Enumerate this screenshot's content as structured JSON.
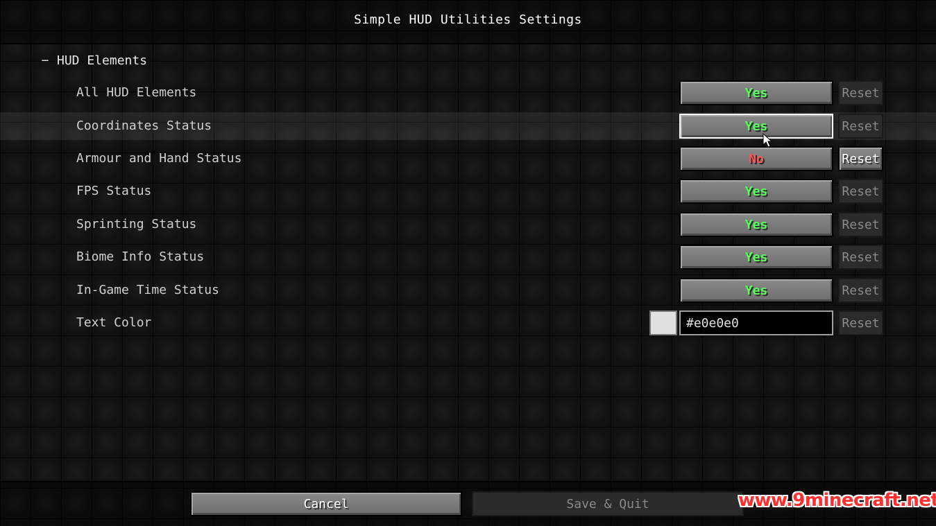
{
  "screen": {
    "title": "Simple HUD Utilities Settings"
  },
  "category": {
    "collapse_symbol": "−",
    "label": "HUD Elements"
  },
  "options": [
    {
      "label": "All HUD Elements",
      "value": "Yes",
      "reset": "Reset",
      "value_color": "#55ff55",
      "reset_enabled": false
    },
    {
      "label": "Coordinates Status",
      "value": "Yes",
      "reset": "Reset",
      "value_color": "#55ff55",
      "reset_enabled": false,
      "hovered": true
    },
    {
      "label": "Armour and Hand Status",
      "value": "No",
      "reset": "Reset",
      "value_color": "#ff5555",
      "reset_enabled": true
    },
    {
      "label": "FPS Status",
      "value": "Yes",
      "reset": "Reset",
      "value_color": "#55ff55",
      "reset_enabled": false
    },
    {
      "label": "Sprinting Status",
      "value": "Yes",
      "reset": "Reset",
      "value_color": "#55ff55",
      "reset_enabled": false
    },
    {
      "label": "Biome Info Status",
      "value": "Yes",
      "reset": "Reset",
      "value_color": "#55ff55",
      "reset_enabled": false
    },
    {
      "label": "In-Game Time Status",
      "value": "Yes",
      "reset": "Reset",
      "value_color": "#55ff55",
      "reset_enabled": false
    }
  ],
  "text_color": {
    "label": "Text Color",
    "value": "#e0e0e0",
    "swatch_color": "#e0e0e0",
    "reset": "Reset"
  },
  "footer": {
    "cancel_label": "Cancel",
    "save_label": "Save & Quit"
  },
  "watermark": {
    "text": "www.9minecraft.net"
  },
  "icons": {
    "cursor": "mouse-pointer-icon"
  }
}
